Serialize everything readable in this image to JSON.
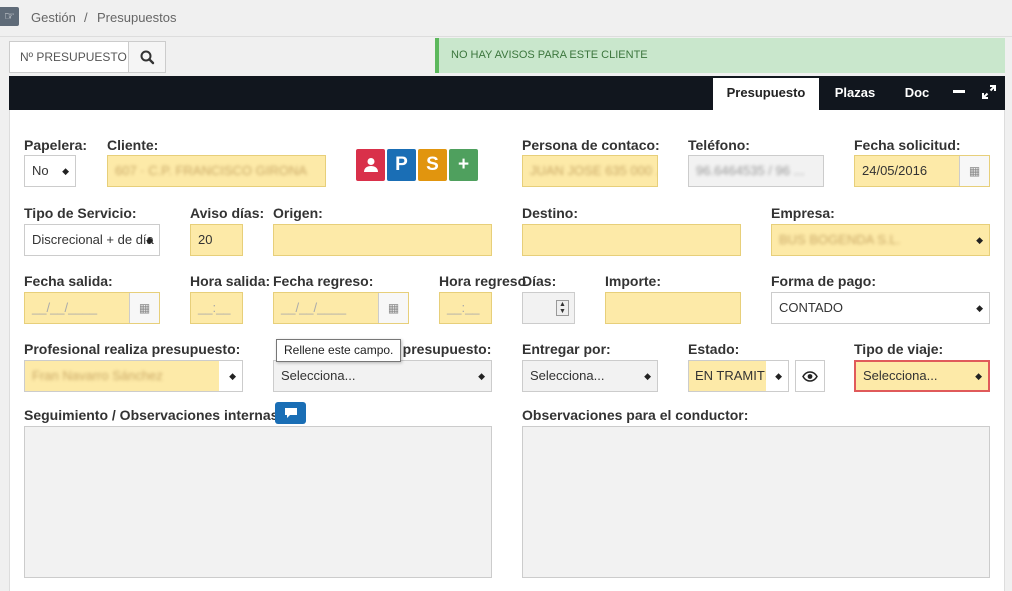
{
  "breadcrumb": {
    "home_icon": "hand-icon",
    "item1": "Gestión",
    "sep": "/",
    "item2": "Presupuestos"
  },
  "search": {
    "value": "Nº PRESUPUESTO",
    "icon": "search-icon"
  },
  "notice": "NO HAY AVISOS PARA ESTE CLIENTE",
  "tabs": [
    "Presupuesto",
    "Plazas",
    "Doc"
  ],
  "window_icons": {
    "minimize": "minimize-icon",
    "expand": "expand-icon"
  },
  "form": {
    "papelera": {
      "label": "Papelera:",
      "value": "No"
    },
    "cliente": {
      "label": "Cliente:",
      "value": "607 · C.P. FRANCISCO GIRONA"
    },
    "action_buttons": [
      {
        "icon": "user-icon",
        "color": "#d9304a"
      },
      {
        "text": "P",
        "color": "#1a6eb5"
      },
      {
        "text": "S",
        "color": "#e1950e"
      },
      {
        "text": "+",
        "color": "#4fa05e"
      }
    ],
    "persona": {
      "label": "Persona de contaco:",
      "value": "JUAN JOSE  635 000 ..."
    },
    "telefono": {
      "label": "Teléfono:",
      "value": "96.6464535  /  96 ..."
    },
    "fecha_solicitud": {
      "label": "Fecha solicitud:",
      "value": "24/05/2016"
    },
    "tipo_servicio": {
      "label": "Tipo de Servicio:",
      "value": "Discrecional + de día"
    },
    "aviso_dias": {
      "label": "Aviso días:",
      "value": "20"
    },
    "origen": {
      "label": "Origen:",
      "value": ""
    },
    "destino": {
      "label": "Destino:",
      "value": ""
    },
    "empresa": {
      "label": "Empresa:",
      "value": "BUS BOGENDA S.L."
    },
    "fecha_salida": {
      "label": "Fecha salida:",
      "value": "__/__/____"
    },
    "hora_salida": {
      "label": "Hora salida:",
      "value": "__:__"
    },
    "fecha_regreso": {
      "label": "Fecha regreso:",
      "value": "__/__/____"
    },
    "hora_regreso": {
      "label": "Hora regreso",
      "value": "__:__"
    },
    "dias": {
      "label": "Días:",
      "value": ""
    },
    "importe": {
      "label": "Importe:",
      "value": ""
    },
    "forma_pago": {
      "label": "Forma de pago:",
      "value": "CONTADO"
    },
    "profesional": {
      "label": "Profesional realiza presupuesto:",
      "value": "Fran Navarro Sánchez"
    },
    "hidden_label": {
      "label_visible": "a presupuesto:",
      "value": "Selecciona..."
    },
    "entregar_por": {
      "label": "Entregar por:",
      "value": "Selecciona..."
    },
    "estado": {
      "label": "Estado:",
      "value": "EN TRAMITE",
      "eye_icon": "eye-icon"
    },
    "tipo_viaje": {
      "label": "Tipo de viaje:",
      "value": "Selecciona..."
    },
    "seguimiento": {
      "label": "Seguimiento / Observaciones internas:",
      "icon": "comment-icon"
    },
    "obs_conductor": {
      "label": "Observaciones para el conductor:"
    }
  },
  "tooltip": "Rellene este campo.",
  "colors": {
    "accent_yellow": "#fdeaa8",
    "dark_bar": "#11161e",
    "notice_green": "#c9e7cc",
    "error_red": "#e05a5a"
  }
}
